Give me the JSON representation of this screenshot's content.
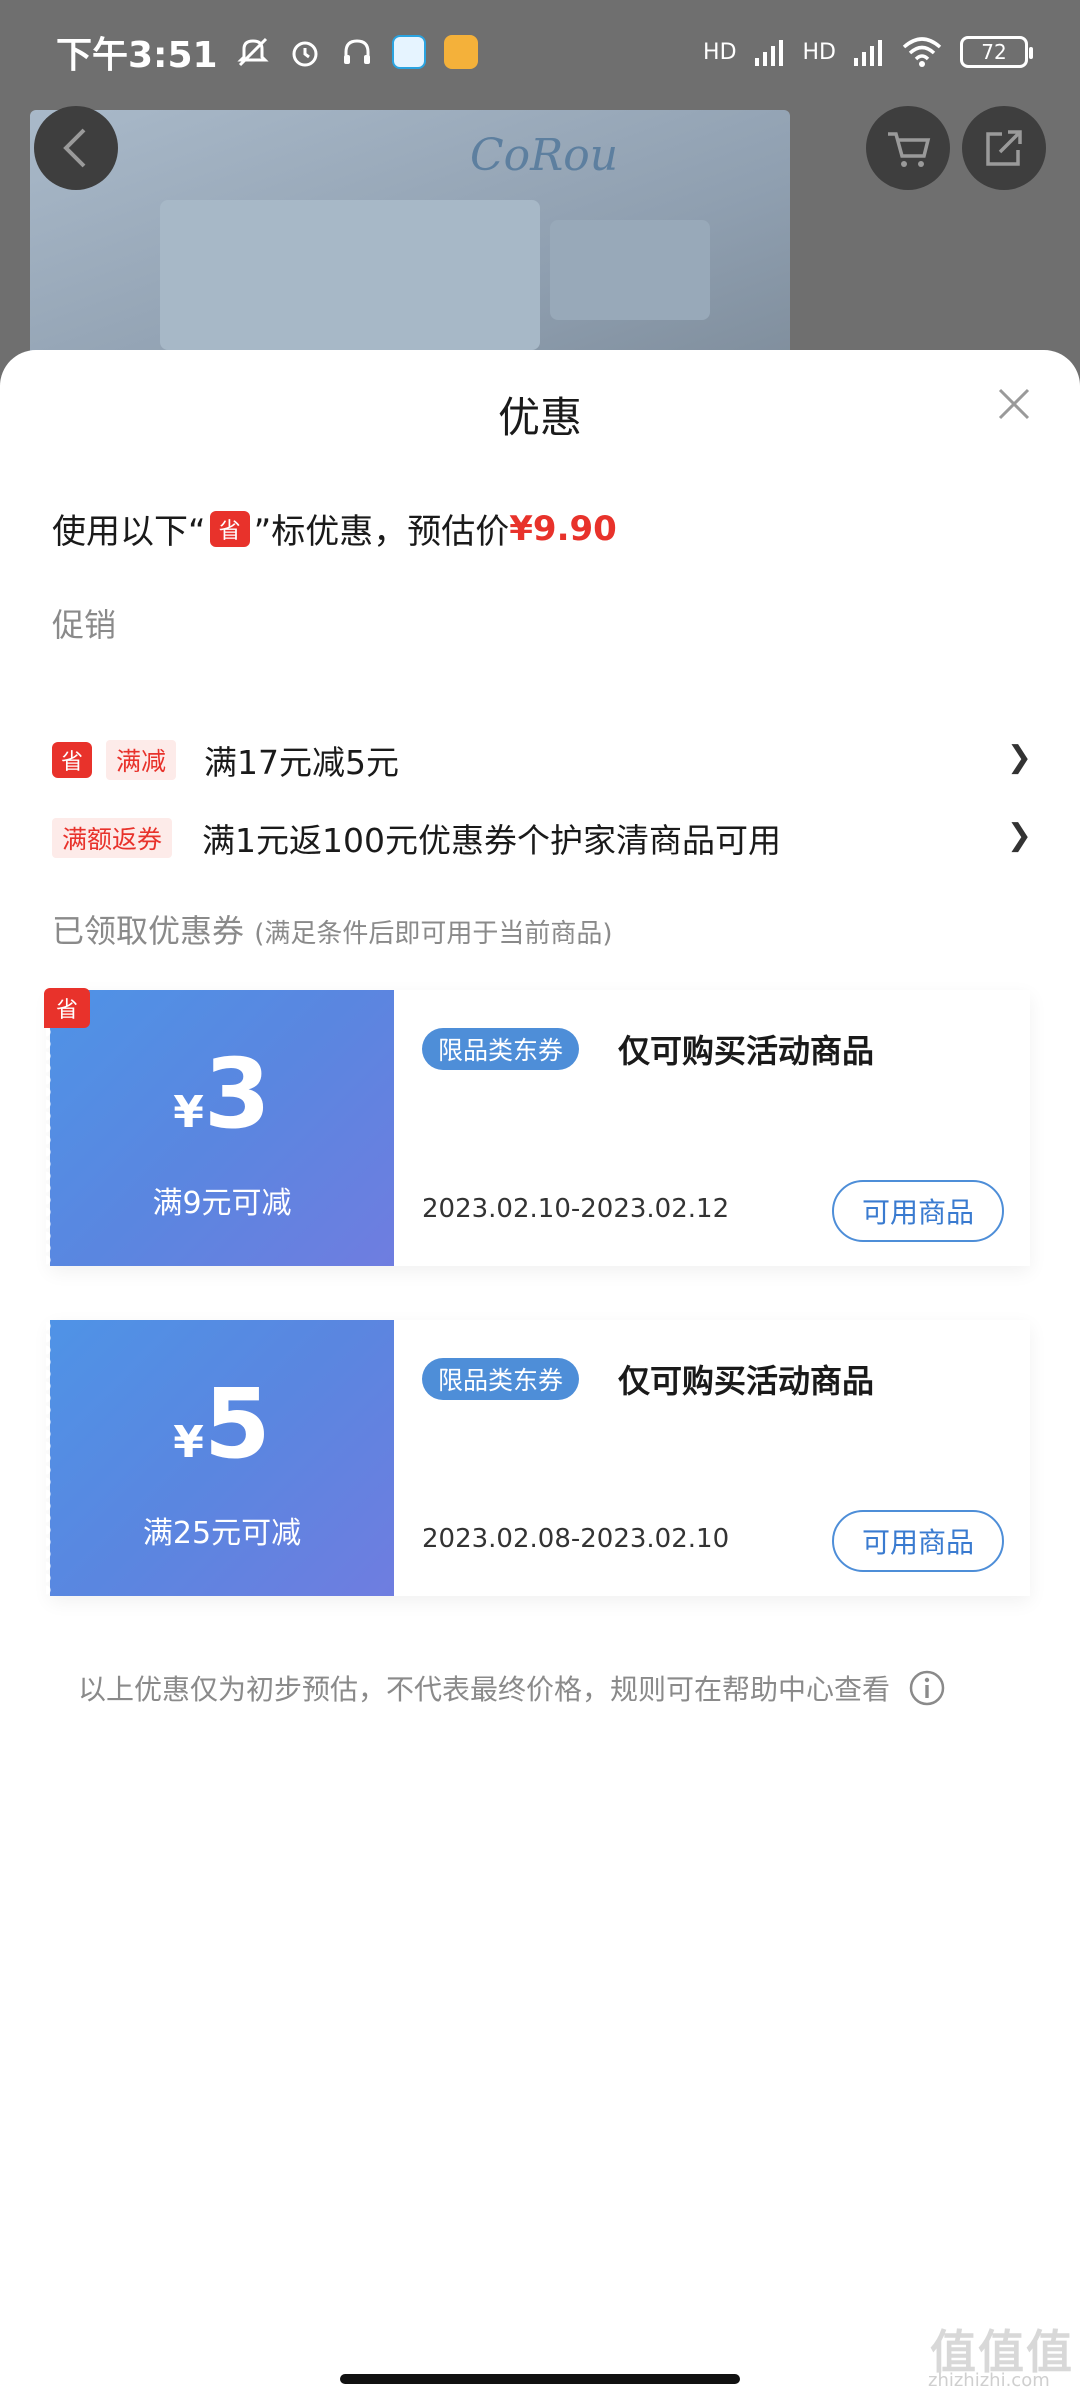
{
  "status_bar": {
    "time": "下午3:51",
    "battery": "72",
    "signal_1": "HD",
    "signal_2": "HD"
  },
  "background": {
    "brand": "CoRou"
  },
  "sheet": {
    "title": "优惠",
    "estimate": {
      "prefix": "使用以下“",
      "badge": "省",
      "suffix": "”标优惠，预估价",
      "price": "¥9.90"
    },
    "promo_section_label": "促销",
    "promotions": [
      {
        "badge": "省",
        "tag": "满减",
        "text": "满17元减5元"
      },
      {
        "tag": "满额返券",
        "text": "满1元返100元优惠券个护家清商品可用"
      }
    ],
    "coupon_section_label": "已领取优惠券",
    "coupon_section_sub": "(满足条件后即可用于当前商品)",
    "coupons": [
      {
        "badge": "省",
        "yen": "¥",
        "amount": "3",
        "condition": "满9元可减",
        "type_tag": "限品类东券",
        "desc": "仅可购买活动商品",
        "date": "2023.02.10-2023.02.12",
        "button": "可用商品"
      },
      {
        "yen": "¥",
        "amount": "5",
        "condition": "满25元可减",
        "type_tag": "限品类东券",
        "desc": "仅可购买活动商品",
        "date": "2023.02.08-2023.02.10",
        "button": "可用商品"
      }
    ],
    "footer_note": "以上优惠仅为初步预估，不代表最终价格，规则可在帮助中心查看"
  },
  "watermark": {
    "text": "值值值",
    "url": "zhizhizhi.com"
  },
  "colors": {
    "accent_red": "#e8322b",
    "coupon_blue": "#4e8ed8"
  }
}
